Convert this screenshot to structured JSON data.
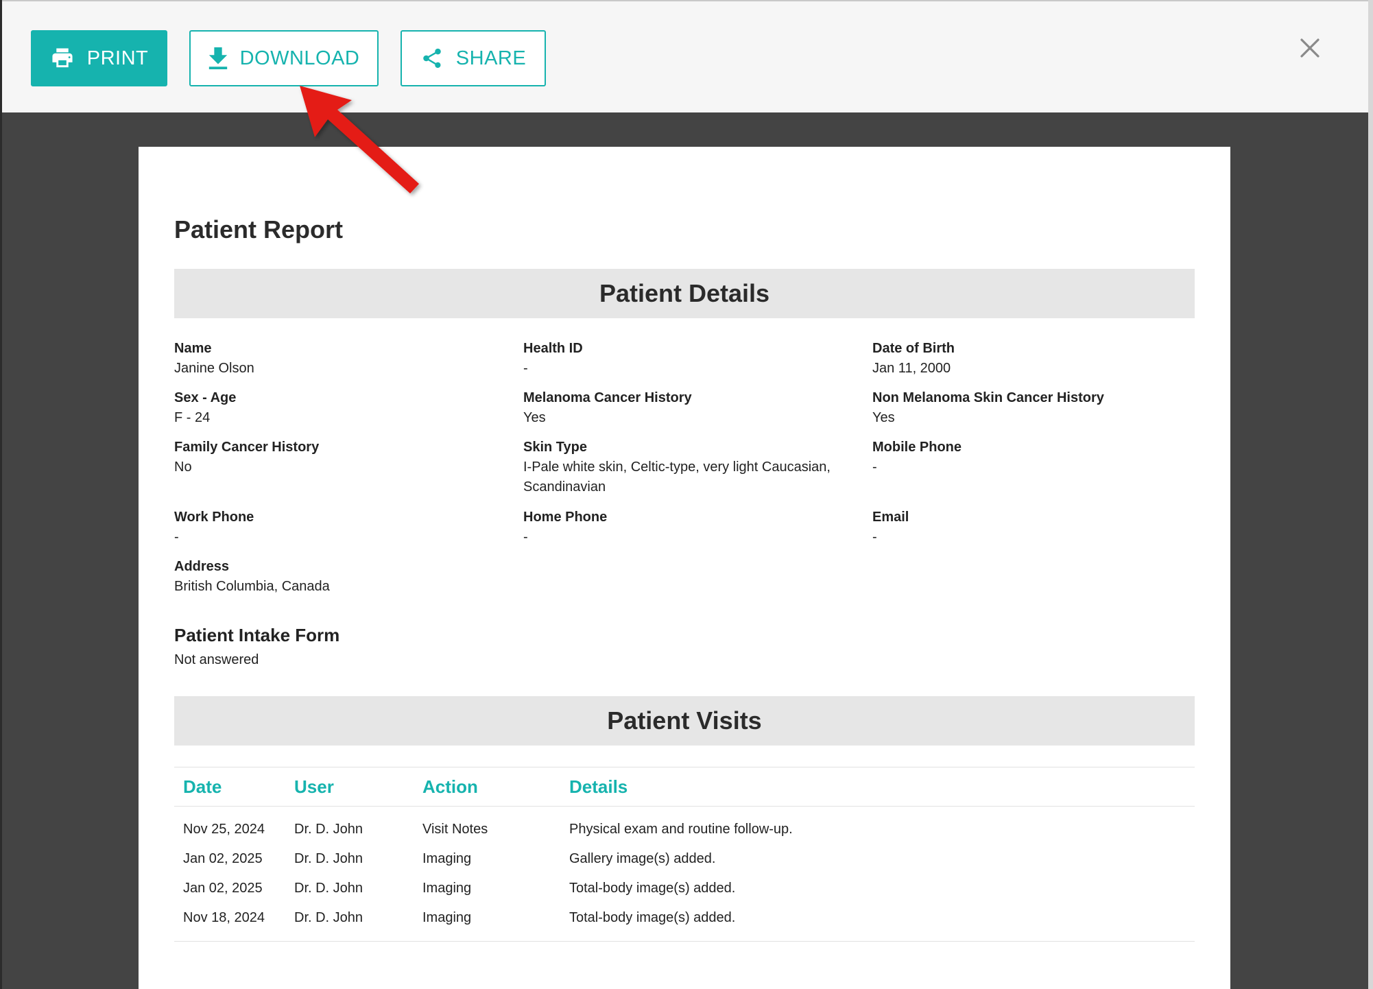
{
  "toolbar": {
    "print_label": "PRINT",
    "download_label": "DOWNLOAD",
    "share_label": "SHARE"
  },
  "colors": {
    "accent": "#16b3ae",
    "overlay": "#444444",
    "annotation_arrow": "#e41b17"
  },
  "icons": {
    "print": "printer-icon",
    "download": "download-icon",
    "share": "share-icon",
    "close": "close-icon"
  },
  "report": {
    "title": "Patient Report",
    "details_heading": "Patient Details",
    "fields": [
      {
        "label": "Name",
        "value": "Janine Olson"
      },
      {
        "label": "Health ID",
        "value": "-"
      },
      {
        "label": "Date of Birth",
        "value": "Jan 11, 2000"
      },
      {
        "label": "Sex - Age",
        "value": "F - 24"
      },
      {
        "label": "Melanoma Cancer History",
        "value": "Yes"
      },
      {
        "label": "Non Melanoma Skin Cancer History",
        "value": "Yes"
      },
      {
        "label": "Family Cancer History",
        "value": "No"
      },
      {
        "label": "Skin Type",
        "value": "I-Pale white skin, Celtic-type, very light Caucasian, Scandinavian"
      },
      {
        "label": "Mobile Phone",
        "value": "-"
      },
      {
        "label": "Work Phone",
        "value": "-"
      },
      {
        "label": "Home Phone",
        "value": "-"
      },
      {
        "label": "Email",
        "value": "-"
      },
      {
        "label": "Address",
        "value": "British Columbia, Canada"
      }
    ],
    "intake_title": "Patient Intake Form",
    "intake_value": "Not answered",
    "visits_heading": "Patient Visits",
    "visits_columns": [
      "Date",
      "User",
      "Action",
      "Details"
    ],
    "visits": [
      [
        "Nov 25, 2024",
        "Dr. D. John",
        "Visit Notes",
        "Physical exam and routine follow-up."
      ],
      [
        "Jan 02, 2025",
        "Dr. D. John",
        "Imaging",
        "Gallery image(s) added."
      ],
      [
        "Jan 02, 2025",
        "Dr. D. John",
        "Imaging",
        "Total-body image(s) added."
      ],
      [
        "Nov 18, 2024",
        "Dr. D. John",
        "Imaging",
        "Total-body image(s) added."
      ]
    ]
  }
}
